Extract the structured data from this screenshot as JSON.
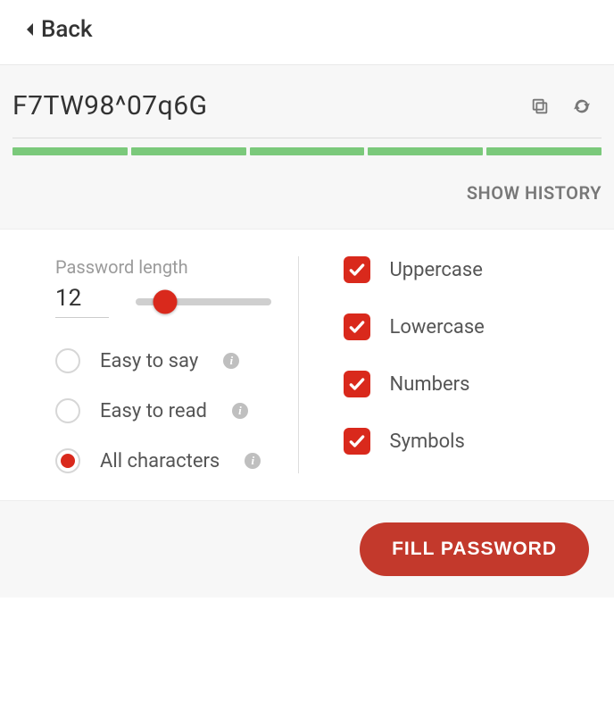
{
  "header": {
    "back_label": "Back"
  },
  "password": {
    "value": "F7TW98^07q6G",
    "history_label": "SHOW HISTORY",
    "strength_segments": 5,
    "strength_color": "#7bc97b"
  },
  "options": {
    "length_label": "Password length",
    "length_value": "12",
    "slider_percent": 22,
    "modes": [
      {
        "label": "Easy to say",
        "selected": false,
        "info": true
      },
      {
        "label": "Easy to read",
        "selected": false,
        "info": true
      },
      {
        "label": "All characters",
        "selected": true,
        "info": true
      }
    ],
    "charsets": [
      {
        "label": "Uppercase",
        "checked": true
      },
      {
        "label": "Lowercase",
        "checked": true
      },
      {
        "label": "Numbers",
        "checked": true
      },
      {
        "label": "Symbols",
        "checked": true
      }
    ]
  },
  "footer": {
    "fill_button_label": "FILL PASSWORD"
  }
}
